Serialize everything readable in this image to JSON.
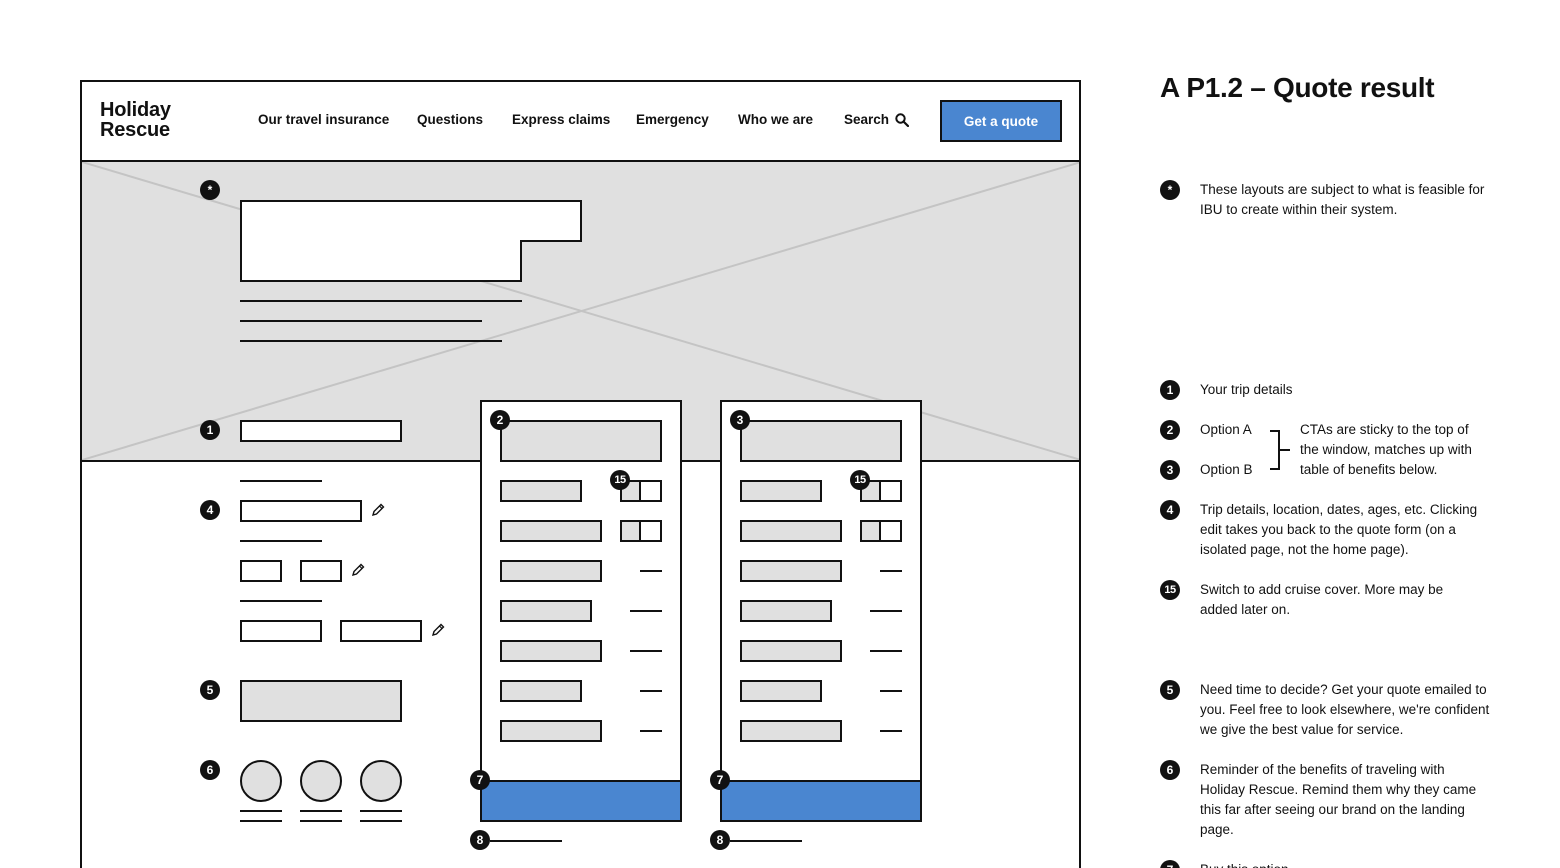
{
  "nav": {
    "logo_line1": "Holiday",
    "logo_line2": "Rescue",
    "items": [
      "Our travel insurance",
      "Questions",
      "Express claims",
      "Emergency",
      "Who we are"
    ],
    "search_label": "Search",
    "cta_label": "Get a quote"
  },
  "markers": {
    "star": "*",
    "m1": "1",
    "m2": "2",
    "m3": "3",
    "m4": "4",
    "m5": "5",
    "m6": "6",
    "m7": "7",
    "m8": "8",
    "m15": "15"
  },
  "panel": {
    "title": "A P1.2 – Quote result",
    "notes": {
      "star": "These layouts are subject to what is feasible for IBU to create within their system.",
      "n1": "Your trip details",
      "n2": "Option A",
      "n3": "Option B",
      "bracket": "CTAs are sticky to the top of the window, matches up with table of benefits below.",
      "n4": "Trip details, location, dates, ages, etc. Clicking edit takes you back to the quote form (on a isolated page, not the home page).",
      "n15": "Switch to add cruise cover. More may be added later on.",
      "n5": "Need time to decide? Get your quote emailed to you. Feel free to look elsewhere, we're confident we give the best value for service.",
      "n6": "Reminder of the benefits of traveling with Holiday Rescue. Remind them why they came this far after seeing our brand on the landing page.",
      "n7": "Buy this option"
    }
  },
  "icons": {
    "search": "search-icon",
    "edit": "pencil-icon",
    "placeholder": "image-placeholder-cross"
  },
  "colors": {
    "accent": "#4a86d0",
    "placeholder_fill": "#e0e0e0",
    "ink": "#111111"
  }
}
